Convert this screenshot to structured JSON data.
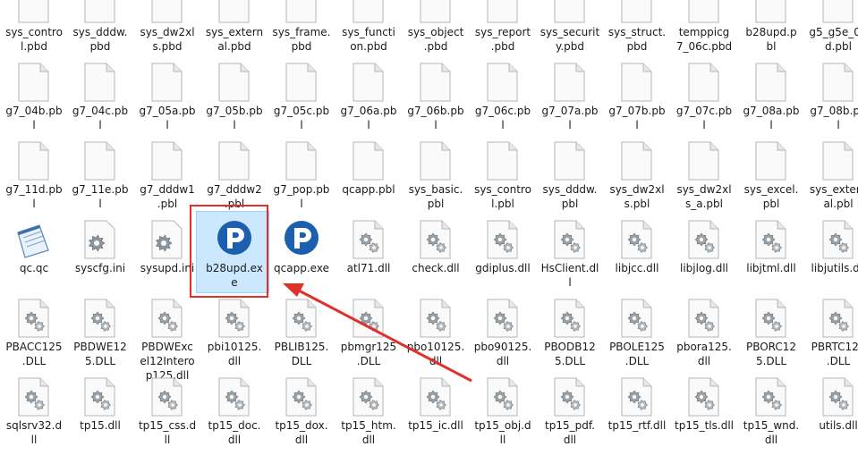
{
  "colors": {
    "accent_red": "#e0302a",
    "selection": "#cce8ff",
    "pb_blue": "#1c5fae"
  },
  "rows": [
    {
      "items": [
        {
          "lines": [
            "sys_contro",
            "l.pbd"
          ],
          "icon": "file-icon"
        },
        {
          "lines": [
            "sys_dddw.",
            "pbd"
          ],
          "icon": "file-icon"
        },
        {
          "lines": [
            "sys_dw2xl",
            "s.pbd"
          ],
          "icon": "file-icon"
        },
        {
          "lines": [
            "sys_extern",
            "al.pbd"
          ],
          "icon": "file-icon"
        },
        {
          "lines": [
            "sys_frame.",
            "pbd"
          ],
          "icon": "file-icon"
        },
        {
          "lines": [
            "sys_functi",
            "on.pbd"
          ],
          "icon": "file-icon"
        },
        {
          "lines": [
            "sys_object",
            ".pbd"
          ],
          "icon": "file-icon"
        },
        {
          "lines": [
            "sys_report",
            ".pbd"
          ],
          "icon": "file-icon"
        },
        {
          "lines": [
            "sys_securit",
            "y.pbd"
          ],
          "icon": "file-icon"
        },
        {
          "lines": [
            "sys_struct.",
            "pbd"
          ],
          "icon": "file-icon"
        },
        {
          "lines": [
            "temppicg",
            "7_06c.pbd"
          ],
          "icon": "file-icon"
        },
        {
          "lines": [
            "b28upd.p",
            "bl"
          ],
          "icon": "file-icon"
        },
        {
          "lines": [
            "g5_g5e_02",
            "d.pbl"
          ],
          "icon": "file-icon"
        }
      ]
    },
    {
      "items": [
        {
          "lines": [
            "g7_04b.pb",
            "l"
          ],
          "icon": "file-icon"
        },
        {
          "lines": [
            "g7_04c.pb",
            "l"
          ],
          "icon": "file-icon"
        },
        {
          "lines": [
            "g7_05a.pb",
            "l"
          ],
          "icon": "file-icon"
        },
        {
          "lines": [
            "g7_05b.pb",
            "l"
          ],
          "icon": "file-icon"
        },
        {
          "lines": [
            "g7_05c.pb",
            "l"
          ],
          "icon": "file-icon"
        },
        {
          "lines": [
            "g7_06a.pb",
            "l"
          ],
          "icon": "file-icon"
        },
        {
          "lines": [
            "g7_06b.pb",
            "l"
          ],
          "icon": "file-icon"
        },
        {
          "lines": [
            "g7_06c.pb",
            "l"
          ],
          "icon": "file-icon"
        },
        {
          "lines": [
            "g7_07a.pb",
            "l"
          ],
          "icon": "file-icon"
        },
        {
          "lines": [
            "g7_07b.pb",
            "l"
          ],
          "icon": "file-icon"
        },
        {
          "lines": [
            "g7_07c.pb",
            "l"
          ],
          "icon": "file-icon"
        },
        {
          "lines": [
            "g7_08a.pb",
            "l"
          ],
          "icon": "file-icon"
        },
        {
          "lines": [
            "g7_08b.pb",
            "l"
          ],
          "icon": "file-icon"
        }
      ]
    },
    {
      "items": [
        {
          "lines": [
            "g7_11d.pb",
            "l"
          ],
          "icon": "file-icon"
        },
        {
          "lines": [
            "g7_11e.pb",
            "l"
          ],
          "icon": "file-icon"
        },
        {
          "lines": [
            "g7_dddw1",
            ".pbl"
          ],
          "icon": "file-icon"
        },
        {
          "lines": [
            "g7_dddw2",
            ".pbl"
          ],
          "icon": "file-icon"
        },
        {
          "lines": [
            "g7_pop.pb",
            "l"
          ],
          "icon": "file-icon"
        },
        {
          "lines": [
            "qcapp.pbl"
          ],
          "icon": "file-icon"
        },
        {
          "lines": [
            "sys_basic.",
            "pbl"
          ],
          "icon": "file-icon"
        },
        {
          "lines": [
            "sys_contro",
            "l.pbl"
          ],
          "icon": "file-icon"
        },
        {
          "lines": [
            "sys_dddw.",
            "pbl"
          ],
          "icon": "file-icon"
        },
        {
          "lines": [
            "sys_dw2xl",
            "s.pbl"
          ],
          "icon": "file-icon"
        },
        {
          "lines": [
            "sys_dw2xl",
            "s_a.pbl"
          ],
          "icon": "file-icon"
        },
        {
          "lines": [
            "sys_excel.",
            "pbl"
          ],
          "icon": "file-icon"
        },
        {
          "lines": [
            "sys_extern",
            "al.pbl"
          ],
          "icon": "file-icon"
        }
      ]
    },
    {
      "items": [
        {
          "lines": [
            "qc.qc"
          ],
          "icon": "notepad-icon"
        },
        {
          "lines": [
            "syscfg.ini"
          ],
          "icon": "settings-gear-icon"
        },
        {
          "lines": [
            "sysupd.ini"
          ],
          "icon": "settings-gear-icon"
        },
        {
          "lines": [
            "b28upd.ex",
            "e"
          ],
          "icon": "powerbuilder-exe-icon",
          "selected": true
        },
        {
          "lines": [
            "qcapp.exe"
          ],
          "icon": "powerbuilder-exe-icon"
        },
        {
          "lines": [
            "atl71.dll"
          ],
          "icon": "dll-gear-icon"
        },
        {
          "lines": [
            "check.dll"
          ],
          "icon": "dll-gear-icon"
        },
        {
          "lines": [
            "gdiplus.dll"
          ],
          "icon": "dll-gear-icon"
        },
        {
          "lines": [
            "HsClient.dl",
            "l"
          ],
          "icon": "dll-gear-icon"
        },
        {
          "lines": [
            "libjcc.dll"
          ],
          "icon": "dll-gear-icon"
        },
        {
          "lines": [
            "libjlog.dll"
          ],
          "icon": "dll-gear-icon"
        },
        {
          "lines": [
            "libjtml.dll"
          ],
          "icon": "dll-gear-icon"
        },
        {
          "lines": [
            "libjutils.dll"
          ],
          "icon": "dll-gear-icon"
        }
      ]
    },
    {
      "items": [
        {
          "lines": [
            "PBACC125",
            ".DLL"
          ],
          "icon": "dll-gear-icon"
        },
        {
          "lines": [
            "PBDWE12",
            "5.DLL"
          ],
          "icon": "dll-gear-icon"
        },
        {
          "lines": [
            "PBDWExc",
            "el12Intero",
            "p125.dll"
          ],
          "icon": "dll-gear-icon"
        },
        {
          "lines": [
            "pbi10125.",
            "dll"
          ],
          "icon": "dll-gear-icon"
        },
        {
          "lines": [
            "PBLIB125.",
            "DLL"
          ],
          "icon": "dll-gear-icon"
        },
        {
          "lines": [
            "pbmgr125",
            ".DLL"
          ],
          "icon": "dll-gear-icon"
        },
        {
          "lines": [
            "pbo10125.",
            "dll"
          ],
          "icon": "dll-gear-icon"
        },
        {
          "lines": [
            "pbo90125.",
            "dll"
          ],
          "icon": "dll-gear-icon"
        },
        {
          "lines": [
            "PBODB12",
            "5.DLL"
          ],
          "icon": "dll-gear-icon"
        },
        {
          "lines": [
            "PBOLE125",
            ".DLL"
          ],
          "icon": "dll-gear-icon"
        },
        {
          "lines": [
            "pbora125.",
            "dll"
          ],
          "icon": "dll-gear-icon"
        },
        {
          "lines": [
            "PBORC12",
            "5.DLL"
          ],
          "icon": "dll-gear-icon"
        },
        {
          "lines": [
            "PBRTC125",
            ".DLL"
          ],
          "icon": "dll-gear-icon"
        }
      ]
    },
    {
      "items": [
        {
          "lines": [
            "sqlsrv32.d",
            "ll"
          ],
          "icon": "dll-gear-icon"
        },
        {
          "lines": [
            "tp15.dll"
          ],
          "icon": "dll-gear-icon"
        },
        {
          "lines": [
            "tp15_css.d",
            "ll"
          ],
          "icon": "dll-gear-icon"
        },
        {
          "lines": [
            "tp15_doc.",
            "dll"
          ],
          "icon": "dll-gear-icon"
        },
        {
          "lines": [
            "tp15_dox.",
            "dll"
          ],
          "icon": "dll-gear-icon"
        },
        {
          "lines": [
            "tp15_htm.",
            "dll"
          ],
          "icon": "dll-gear-icon"
        },
        {
          "lines": [
            "tp15_ic.dll"
          ],
          "icon": "dll-gear-icon"
        },
        {
          "lines": [
            "tp15_obj.d",
            "ll"
          ],
          "icon": "dll-gear-icon"
        },
        {
          "lines": [
            "tp15_pdf.",
            "dll"
          ],
          "icon": "dll-gear-icon"
        },
        {
          "lines": [
            "tp15_rtf.dll"
          ],
          "icon": "dll-gear-icon"
        },
        {
          "lines": [
            "tp15_tls.dll"
          ],
          "icon": "dll-gear-icon"
        },
        {
          "lines": [
            "tp15_wnd.",
            "dll"
          ],
          "icon": "dll-gear-icon"
        },
        {
          "lines": [
            "utils.dll"
          ],
          "icon": "dll-gear-icon"
        }
      ]
    }
  ]
}
